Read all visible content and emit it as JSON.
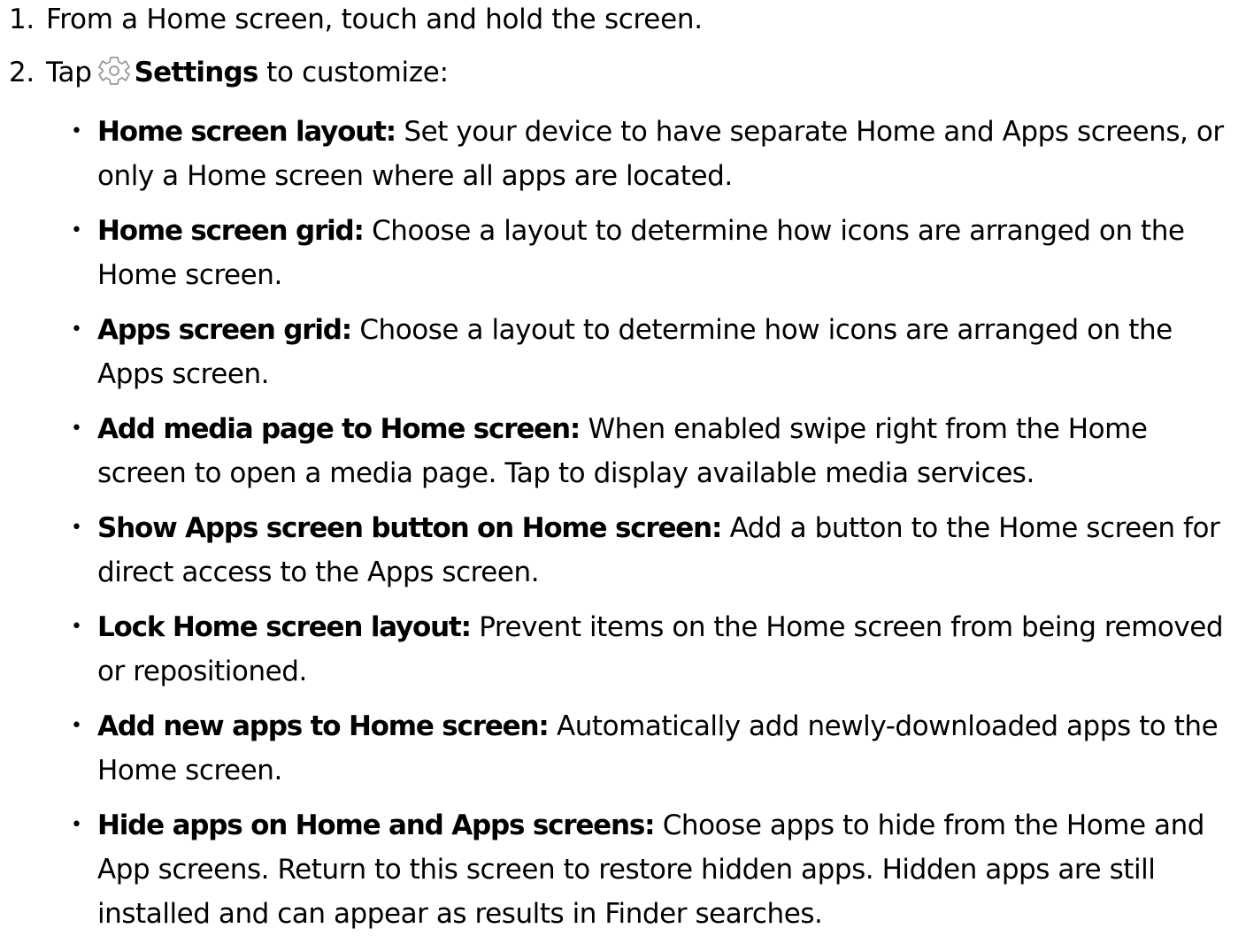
{
  "steps": [
    {
      "number": "1.",
      "text": "From a Home screen, touch and hold the screen."
    },
    {
      "number": "2.",
      "text_before": "Tap",
      "icon": "settings-gear-icon",
      "bold": "Settings",
      "text_after": " to customize:"
    }
  ],
  "bullet_char": "•",
  "options": [
    {
      "term": "Home screen layout:",
      "description": " Set your device to have separate Home and Apps screens, or only a Home screen where all apps are located."
    },
    {
      "term": "Home screen grid:",
      "description": " Choose a layout to determine how icons are arranged on the Home screen."
    },
    {
      "term": "Apps screen grid:",
      "description": " Choose a layout to determine how icons are arranged on the Apps screen."
    },
    {
      "term": "Add media page to Home screen:",
      "description": " When enabled swipe right from the Home screen to open a media page. Tap to display available media services."
    },
    {
      "term": "Show Apps screen button on Home screen:",
      "description": " Add a button to the Home screen for direct access to the Apps screen."
    },
    {
      "term": "Lock Home screen layout:",
      "description": " Prevent items on the Home screen from being removed or repositioned."
    },
    {
      "term": "Add new apps to Home screen:",
      "description": " Automatically add newly-downloaded apps to the Home screen."
    },
    {
      "term": "Hide apps on Home and Apps screens:",
      "description": " Choose apps to hide from the Home and App screens. Return to this screen to restore hidden apps. Hidden apps are still installed and can appear as results in Finder searches."
    }
  ]
}
